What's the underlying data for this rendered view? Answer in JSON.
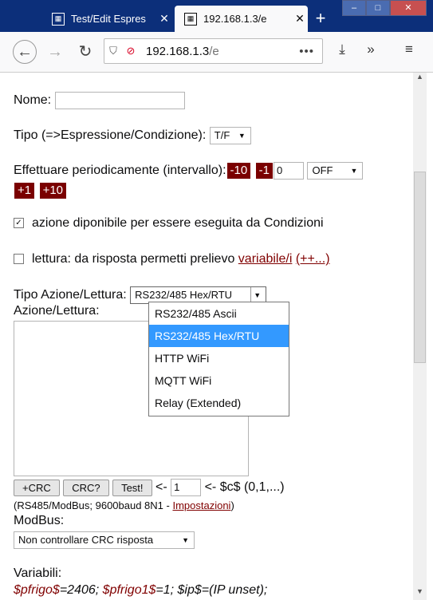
{
  "tabs": [
    {
      "title": "Test/Edit Espres",
      "favicon": "grid-icon"
    },
    {
      "title": "192.168.1.3/e",
      "favicon": "grid-icon"
    }
  ],
  "window": {
    "menu_icon": "system-menu",
    "minimize": "–",
    "maximize": "□",
    "close": "✕"
  },
  "new_tab": "+",
  "urlbar": {
    "host": "192.168.1.3",
    "path": "/e",
    "dots": "•••"
  },
  "form": {
    "nome_label": "Nome:",
    "tipo_label": "Tipo (=>Espressione/Condizione):",
    "tipo_value": "T/F",
    "periodic_label": "Effettuare periodicamente (intervallo):",
    "minus10": "-10",
    "minus1": "-1",
    "interval_value": "0",
    "interval_unit": "OFF",
    "plus1": "+1",
    "plus10": "+10",
    "check1_label": "azione diponibile per essere eseguita da Condizioni",
    "check2_label": "lettura: da risposta permetti prelievo",
    "check2_link": "variabile/i",
    "check2_more": "(++...)",
    "tipo_azione_label": "Tipo Azione/Lettura:",
    "tipo_azione_value": "RS232/485 Hex/RTU",
    "azione_label": "Azione/Lettura:",
    "dropdown_options": [
      "RS232/485 Ascii",
      "RS232/485 Hex/RTU",
      "HTTP WiFi",
      "MQTT WiFi",
      "Relay (Extended)"
    ],
    "crc_btn": "+CRC",
    "crcq_btn": "CRC?",
    "test_btn": "Test!",
    "arrow1": "<-",
    "c_value": "1",
    "c_label": "<- $c$ (0,1,...)",
    "note": "(RS485/ModBus; 9600baud 8N1 - ",
    "note_link": "Impostazioni",
    "note_end": ")",
    "modbus_label": "ModBus:",
    "modbus_value": "Non controllare CRC risposta",
    "variabili_label": "Variabili:",
    "var1_name": "$pfrigo$",
    "var1_val": "=2406;",
    "var2_name": "$pfrigo1$",
    "var2_val": "=1;",
    "var3": "$ip$=(IP unset);"
  }
}
